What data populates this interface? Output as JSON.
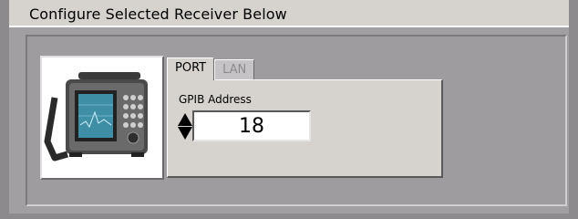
{
  "panel": {
    "title": "Configure Selected Receiver Below"
  },
  "device_image": {
    "icon": "receiver-instrument-icon",
    "screen_color": "#3e8ea6"
  },
  "tabs": [
    {
      "label": "PORT",
      "active": true
    },
    {
      "label": "LAN",
      "active": false
    }
  ],
  "port": {
    "gpib_label": "GPIB Address",
    "gpib_value": "18"
  },
  "colors": {
    "panel_bg": "#d6d3ce",
    "frame_bg": "#9c9a9c"
  }
}
